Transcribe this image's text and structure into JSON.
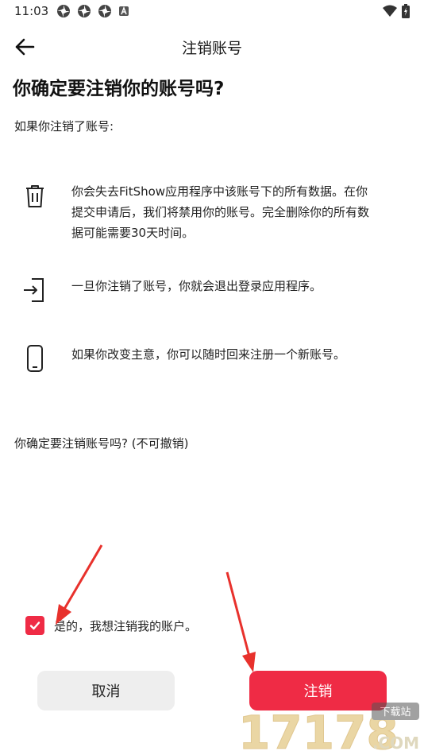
{
  "status_bar": {
    "time": "11:03",
    "notification_icons": [
      "pinwheel-icon",
      "pinwheel-icon",
      "pinwheel-icon",
      "letter-a-icon"
    ]
  },
  "app_bar": {
    "title": "注销账号"
  },
  "headline": "你确定要注销你的账号吗?",
  "intro": "如果你注销了账号:",
  "items": [
    {
      "icon": "trash-icon",
      "lines": [
        "你会失去FitShow应用程序中该账号下的所有数据。在你",
        "提交申请后，我们将禁用你的账号。完全删除你的所有数",
        "据可能需要30天时间。"
      ]
    },
    {
      "icon": "logout-icon",
      "lines": [
        "一旦你注销了账号，你就会退出登录应用程序。"
      ]
    },
    {
      "icon": "phone-icon",
      "lines": [
        "如果你改变主意，你可以随时回来注册一个新账号。"
      ]
    }
  ],
  "confirm_question": "你确定要注销账号吗? (不可撤销)",
  "agree": {
    "checked": true,
    "label": "是的，我想注销我的账户。"
  },
  "buttons": {
    "cancel": "取消",
    "confirm": "注销"
  },
  "watermark": {
    "line1": "17178",
    "tag": "下载站",
    "domain": ".COM"
  },
  "colors": {
    "accent": "#ef2b45",
    "cancel_bg": "#eeeeee",
    "annotation_arrow": "#e8312c"
  }
}
